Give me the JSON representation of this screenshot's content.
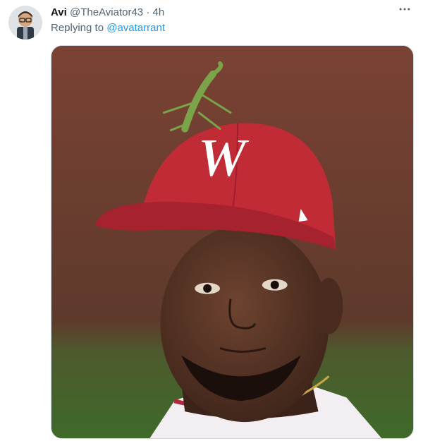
{
  "tweet": {
    "author_name": "Avi",
    "author_handle": "@TheAviator43",
    "separator": "·",
    "timestamp": "4h",
    "reply_prefix": "Replying to",
    "reply_mention": "@avatarrant"
  },
  "icons": {
    "avatar": "avatar-icon",
    "more": "more-options-icon"
  },
  "media": {
    "description_icon": "photo",
    "cap_logo": "W"
  },
  "colors": {
    "link": "#1d9bf0",
    "secondary_text": "#536471",
    "cap_red": "#c12b36"
  }
}
